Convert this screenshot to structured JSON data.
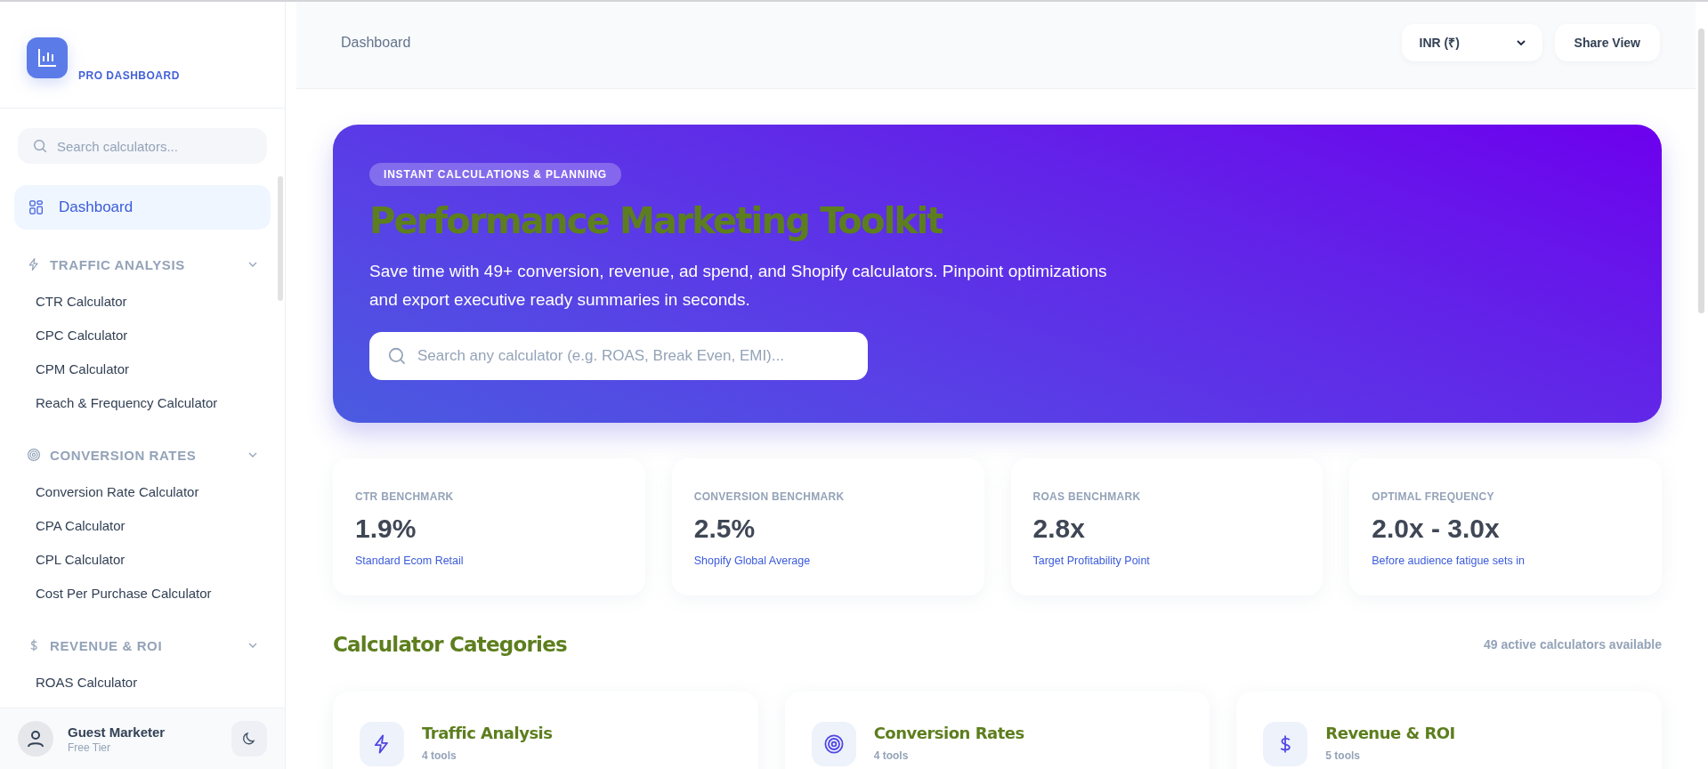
{
  "brand": {
    "name": "PRO DASHBOARD"
  },
  "sidebar": {
    "search": {
      "placeholder": "Search calculators..."
    },
    "dashboard": {
      "label": "Dashboard",
      "selected": true
    },
    "sections": [
      {
        "title": "TRAFFIC ANALYSIS",
        "expanded": true,
        "items": [
          "CTR Calculator",
          "CPC Calculator",
          "CPM Calculator",
          "Reach & Frequency Calculator"
        ]
      },
      {
        "title": "CONVERSION RATES",
        "expanded": true,
        "items": [
          "Conversion Rate Calculator",
          "CPA Calculator",
          "CPL Calculator",
          "Cost Per Purchase Calculator"
        ]
      },
      {
        "title": "REVENUE & ROI",
        "expanded": true,
        "items": [
          "ROAS Calculator"
        ]
      }
    ],
    "user": {
      "name": "Guest Marketer",
      "tier": "Free Tier"
    }
  },
  "header": {
    "title": "Dashboard",
    "currency": "INR (₹)",
    "share": "Share View"
  },
  "hero": {
    "badge": "INSTANT CALCULATIONS & PLANNING",
    "title": "Performance Marketing Toolkit",
    "text": "Save time with 49+ conversion, revenue, ad spend, and Shopify calculators. Pinpoint optimizations and export executive ready summaries in seconds.",
    "search": {
      "placeholder": "Search any calculator (e.g. ROAS, Break Even, EMI)..."
    }
  },
  "stats": [
    {
      "label": "CTR BENCHMARK",
      "value": "1.9%",
      "note": "Standard Ecom Retail"
    },
    {
      "label": "CONVERSION BENCHMARK",
      "value": "2.5%",
      "note": "Shopify Global Average"
    },
    {
      "label": "ROAS BENCHMARK",
      "value": "2.8x",
      "note": "Target Profitability Point"
    },
    {
      "label": "OPTIMAL FREQUENCY",
      "value": "2.0x - 3.0x",
      "note": "Before audience fatigue sets in"
    }
  ],
  "categories": {
    "title": "Calculator Categories",
    "count": "49 active calculators available",
    "cards": [
      {
        "name": "Traffic Analysis",
        "tools": "4 tools"
      },
      {
        "name": "Conversion Rates",
        "tools": "4 tools"
      },
      {
        "name": "Revenue & ROI",
        "tools": "5 tools"
      }
    ]
  }
}
